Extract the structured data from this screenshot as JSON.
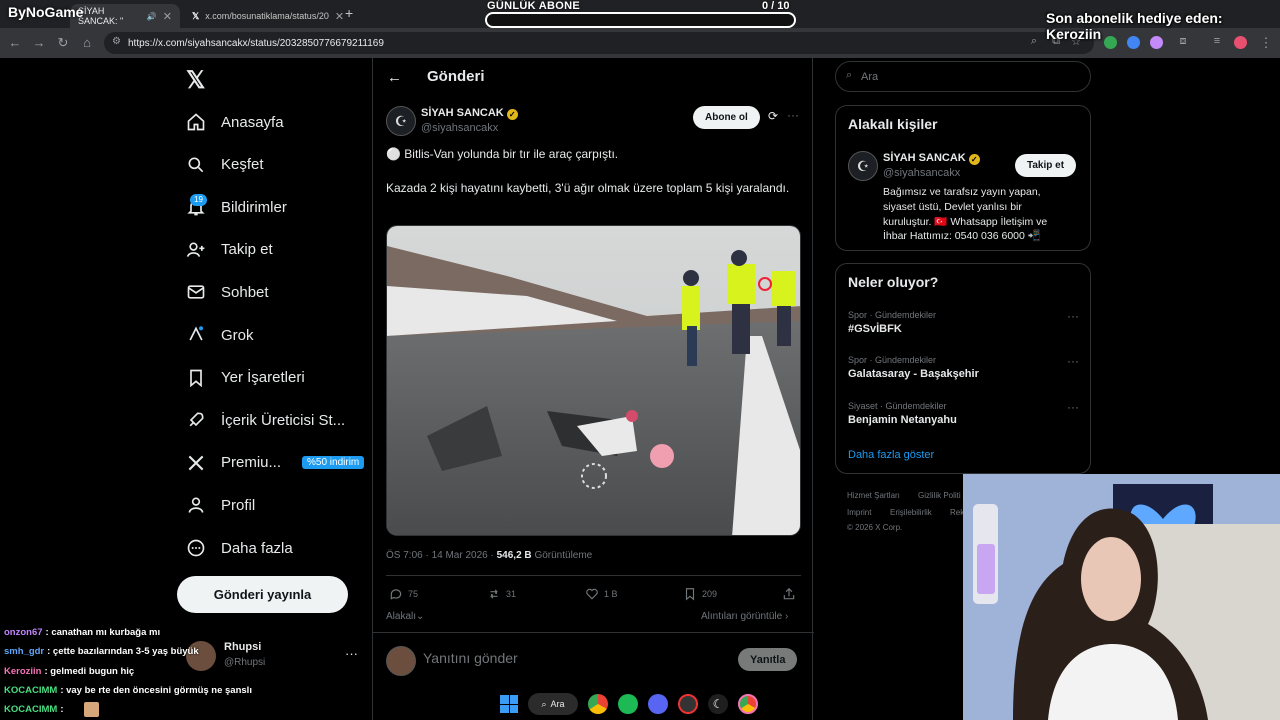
{
  "browser": {
    "tabs": [
      {
        "label": "SİYAH SANCAK: \"",
        "active": true
      },
      {
        "label": "x.com/bosunatiklama/status/20",
        "active": false
      }
    ],
    "url": "https://x.com/siyahsancakx/status/2032850776679211169"
  },
  "stream": {
    "brand": "ByNoGame",
    "sub_goal_label": "GÜNLÜK ABONE",
    "sub_goal_count": "0 / 10",
    "sub_goal_fraction": 0.0,
    "gift_text": "Son abonelik hediye eden: Keroziin"
  },
  "nav": {
    "items": [
      {
        "label": "Anasayfa",
        "icon": "home-icon"
      },
      {
        "label": "Keşfet",
        "icon": "search-icon"
      },
      {
        "label": "Bildirimler",
        "icon": "bell-icon"
      },
      {
        "label": "Takip et",
        "icon": "follow-icon"
      },
      {
        "label": "Sohbet",
        "icon": "mail-icon"
      },
      {
        "label": "Grok",
        "icon": "grok-icon"
      },
      {
        "label": "Yer İşaretleri",
        "icon": "bookmark-icon"
      },
      {
        "label": "İçerik Üreticisi St...",
        "icon": "rocket-icon"
      },
      {
        "label": "Premiu...",
        "icon": "x-icon"
      },
      {
        "label": "Profil",
        "icon": "user-icon"
      },
      {
        "label": "Daha fazla",
        "icon": "more-circle-icon"
      }
    ],
    "notif_badge": "19",
    "premium_promo": "%50 indirim",
    "post_button": "Gönderi yayınla"
  },
  "post": {
    "header": "Gönderi",
    "author_name": "SİYAH SANCAK",
    "author_handle": "@siyahsancakx",
    "follow_label": "Abone ol",
    "text1": "⚪ Bitlis-Van yolunda bir tır ile araç çarpıştı.",
    "text2": "Kazada 2 kişi hayatını kaybetti, 3'ü ağır olmak üzere toplam 5 kişi yaralandı.",
    "time": "ÖS 7:06 · 14 Mar 2026 ·",
    "views_count": "546,2 B",
    "views_label": "Görüntüleme",
    "replies": "75",
    "reposts": "31",
    "likes": "1 B",
    "bookmarks": "209",
    "relevant_label": "Alakalı",
    "quotes_label": "Alıntıları görüntüle",
    "reply_placeholder": "Yanıtını gönder",
    "reply_button": "Yanıtla"
  },
  "right": {
    "search_placeholder": "Ara",
    "related_title": "Alakalı kişiler",
    "related_name": "SİYAH SANCAK",
    "related_handle": "@siyahsancakx",
    "related_follow": "Takip et",
    "related_bio_1": "Bağımsız ve tarafsız yayın yapan,",
    "related_bio_2": "siyaset üstü, Devlet yanlısı bir",
    "related_bio_3": "kuruluştur. 🇹🇷 Whatsapp İletişim ve",
    "related_bio_4": "İhbar Hattımız: 0540 036 6000 📲",
    "trends_title": "Neler oluyor?",
    "trends": [
      {
        "category": "Spor · Gündemdekiler",
        "name": "#GSvİBFK"
      },
      {
        "category": "Spor · Gündemdekiler",
        "name": "Galatasaray - Başakşehir"
      },
      {
        "category": "Siyaset · Gündemdekiler",
        "name": "Benjamin Netanyahu"
      }
    ],
    "show_more": "Daha fazla göster",
    "footer": [
      "Hizmet Şartları",
      "Gizlilik Politi",
      "Imprint",
      "Erişilebilirlik",
      "Rek",
      "© 2026 X Corp."
    ]
  },
  "chat": [
    {
      "user": "onzon67",
      "color": "#c084fc",
      "message": ": canathan mı kurbağa mı"
    },
    {
      "user": "smh_gdr",
      "color": "#60a5fa",
      "message": ": çette bazılarından 3-5 yaş büyük"
    },
    {
      "user": "Keroziin",
      "color": "#f472b6",
      "message": ": gelmedi bugun hiç"
    },
    {
      "user": "KOCACIMM",
      "color": "#4ade80",
      "message": ": vay be rte den öncesini görmüş ne şanslı"
    },
    {
      "user": "KOCACIMM",
      "color": "#4ade80",
      "message": ":"
    }
  ],
  "account": {
    "name": "Rhupsi",
    "handle": "@Rhupsi"
  },
  "taskbar": {
    "search_label": "Ara"
  }
}
